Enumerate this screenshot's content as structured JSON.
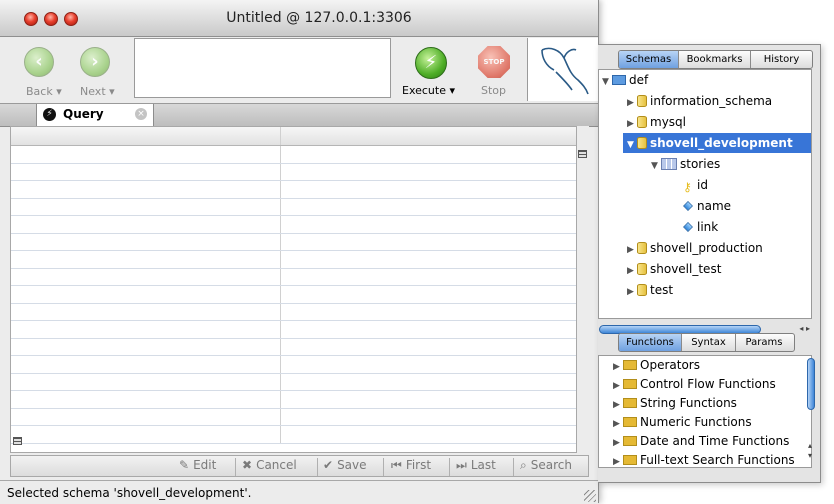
{
  "window": {
    "title": "Untitled @ 127.0.0.1:3306"
  },
  "toolbar": {
    "back_label": "Back ▾",
    "next_label": "Next ▾",
    "execute_label": "Execute ▾",
    "stop_label": "Stop",
    "stop_badge": "STOP"
  },
  "tab": {
    "label": "Query"
  },
  "editbar": {
    "edit": "Edit",
    "cancel": "Cancel",
    "save": "Save",
    "first": "First",
    "last": "Last",
    "search": "Search"
  },
  "status": {
    "text": "Selected schema 'shovell_development'."
  },
  "drawer": {
    "top_tabs": [
      "Schemas",
      "Bookmarks",
      "History"
    ],
    "top_active": "Schemas",
    "tree": [
      {
        "label": "def"
      },
      {
        "label": "information_schema"
      },
      {
        "label": "mysql"
      },
      {
        "label": "shovell_development"
      },
      {
        "label": "stories"
      },
      {
        "label": "id"
      },
      {
        "label": "name"
      },
      {
        "label": "link"
      },
      {
        "label": "shovell_production"
      },
      {
        "label": "shovell_test"
      },
      {
        "label": "test"
      }
    ],
    "bottom_tabs": [
      "Functions",
      "Syntax",
      "Params"
    ],
    "bottom_active": "Functions",
    "functions": [
      "Operators",
      "Control Flow Functions",
      "String Functions",
      "Numeric Functions",
      "Date and Time Functions",
      "Full-text Search Functions"
    ]
  }
}
